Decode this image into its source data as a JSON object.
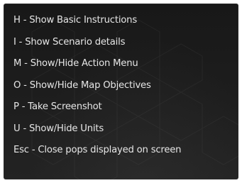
{
  "shortcuts": [
    {
      "label": "H - Show Basic Instructions"
    },
    {
      "label": "I - Show Scenario details"
    },
    {
      "label": "M - Show/Hide Action Menu"
    },
    {
      "label": "O - Show/Hide Map Objectives"
    },
    {
      "label": "P - Take Screenshot"
    },
    {
      "label": "U - Show/Hide Units"
    },
    {
      "label": "Esc - Close pops displayed on screen"
    }
  ],
  "colors": {
    "panel_background": "#1b1b1b",
    "text": "#e6e6e6"
  }
}
